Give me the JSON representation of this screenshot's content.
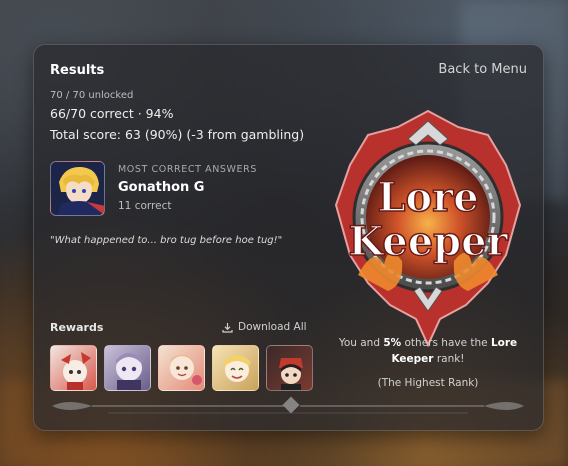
{
  "header": {
    "title": "Results",
    "back_label": "Back to Menu"
  },
  "stats": {
    "unlocked": "70 / 70 unlocked",
    "correct": "66/70 correct · 94%",
    "score": "Total score: 63 (90%) (-3 from gambling)"
  },
  "top_player": {
    "label": "MOST CORRECT ANSWERS",
    "name": "Gonathon G",
    "count": "11 correct"
  },
  "quote": "\"What happened to... bro tug before hoe tug!\"",
  "rewards": {
    "label": "Rewards",
    "download_label": "Download All",
    "items": [
      "reward-1",
      "reward-2",
      "reward-3",
      "reward-4",
      "reward-5"
    ]
  },
  "rank": {
    "badge_line1": "Lore",
    "badge_line2": "Keeper",
    "prefix": "You and ",
    "percent": "5%",
    "middle": " others have the ",
    "name": "Lore Keeper",
    "suffix": " rank!",
    "note": "(The Highest Rank)"
  },
  "colors": {
    "badge_red": "#b8312c",
    "badge_gold": "#e0a040",
    "panel_bg": "#28282c"
  }
}
